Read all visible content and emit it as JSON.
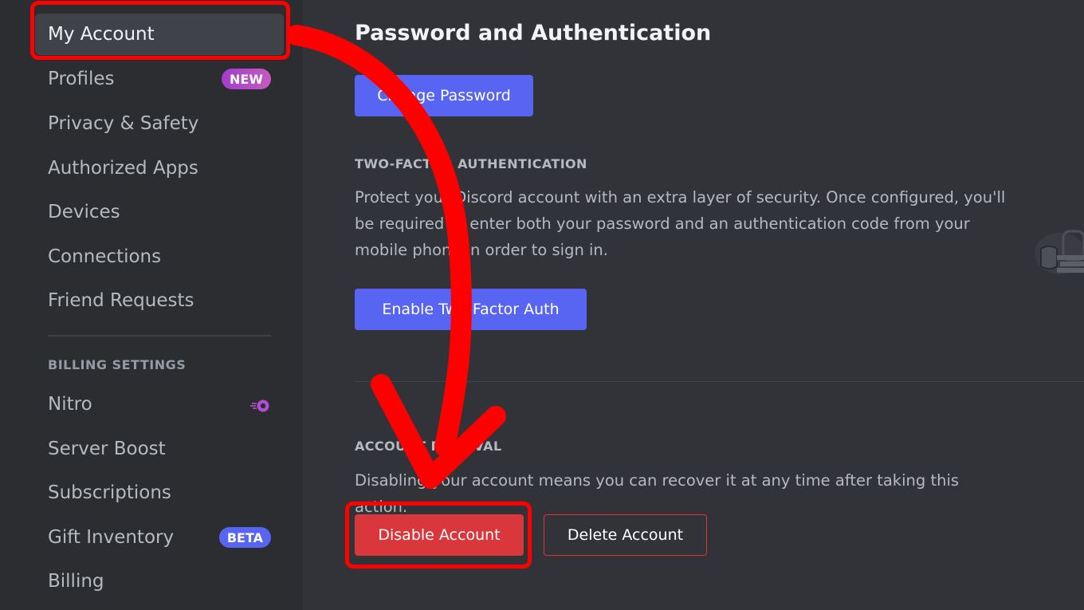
{
  "sidebar": {
    "items": [
      {
        "label": "My Account",
        "selected": true
      },
      {
        "label": "Profiles",
        "badge": "NEW"
      },
      {
        "label": "Privacy & Safety"
      },
      {
        "label": "Authorized Apps"
      },
      {
        "label": "Devices"
      },
      {
        "label": "Connections"
      },
      {
        "label": "Friend Requests"
      }
    ],
    "billing_header": "BILLING SETTINGS",
    "billing_items": [
      {
        "label": "Nitro",
        "icon": "nitro-icon"
      },
      {
        "label": "Server Boost"
      },
      {
        "label": "Subscriptions"
      },
      {
        "label": "Gift Inventory",
        "badge": "BETA"
      },
      {
        "label": "Billing"
      }
    ]
  },
  "main": {
    "title": "Password and Authentication",
    "change_password_label": "Change Password",
    "two_factor": {
      "header": "TWO-FACTOR AUTHENTICATION",
      "description": "Protect your Discord account with an extra layer of security. Once configured, you'll be required to enter both your password and an authentication code from your mobile phone in order to sign in.",
      "button_label": "Enable Two-Factor Auth"
    },
    "account_removal": {
      "header": "ACCOUNT REMOVAL",
      "description": "Disabling your account means you can recover it at any time after taking this action.",
      "disable_label": "Disable Account",
      "delete_label": "Delete Account"
    }
  },
  "colors": {
    "accent": "#5865f2",
    "danger": "#da373c",
    "annotation": "#ff0000"
  }
}
